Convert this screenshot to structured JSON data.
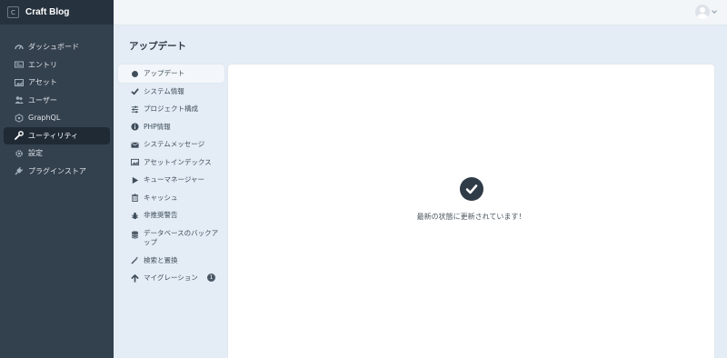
{
  "brand": {
    "logo_letter": "C",
    "name": "Craft Blog"
  },
  "global_nav": [
    {
      "label": "ダッシュボード",
      "icon": "gauge-icon",
      "active": false
    },
    {
      "label": "エントリ",
      "icon": "newspaper-icon",
      "active": false
    },
    {
      "label": "アセット",
      "icon": "image-icon",
      "active": false
    },
    {
      "label": "ユーザー",
      "icon": "users-icon",
      "active": false
    },
    {
      "label": "GraphQL",
      "icon": "graphql-icon",
      "active": false
    },
    {
      "label": "ユーティリティ",
      "icon": "wrench-icon",
      "active": true
    },
    {
      "label": "設定",
      "icon": "gear-icon",
      "active": false
    },
    {
      "label": "プラグインストア",
      "icon": "plug-icon",
      "active": false
    }
  ],
  "page": {
    "title": "アップデート"
  },
  "sub_nav": [
    {
      "label": "アップデート",
      "icon": "craft-icon",
      "active": true
    },
    {
      "label": "システム情報",
      "icon": "check-icon",
      "active": false
    },
    {
      "label": "プロジェクト構成",
      "icon": "sliders-icon",
      "active": false
    },
    {
      "label": "PHP情報",
      "icon": "info-icon",
      "active": false
    },
    {
      "label": "システムメッセージ",
      "icon": "envelope-icon",
      "active": false
    },
    {
      "label": "アセットインデックス",
      "icon": "image-icon",
      "active": false
    },
    {
      "label": "キューマネージャー",
      "icon": "play-icon",
      "active": false
    },
    {
      "label": "キャッシュ",
      "icon": "trash-icon",
      "active": false
    },
    {
      "label": "非推奨警告",
      "icon": "bug-icon",
      "active": false
    },
    {
      "label": "データベースのバックアップ",
      "icon": "database-icon",
      "active": false
    },
    {
      "label": "検索と置換",
      "icon": "wand-icon",
      "active": false
    },
    {
      "label": "マイグレーション",
      "icon": "arrow-up-icon",
      "active": false,
      "badge": "1"
    }
  ],
  "content": {
    "status_message": "最新の状態に更新されています！"
  },
  "colors": {
    "sidebar_bg": "#33404d",
    "brand_bg": "#26323e",
    "page_bg": "#e4edf6",
    "accent_dark": "#2f3b47"
  }
}
